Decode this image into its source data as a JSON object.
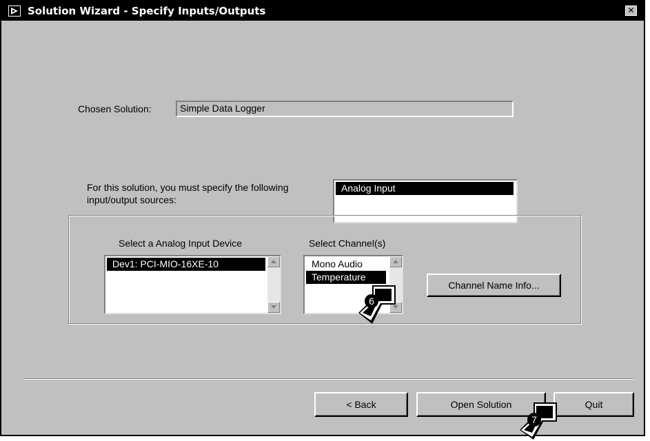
{
  "window": {
    "title": "Solution Wizard - Specify Inputs/Outputs"
  },
  "chosen_solution": {
    "label": "Chosen Solution:",
    "value": "Simple Data Logger"
  },
  "io_sources": {
    "instructions": "For this solution, you must specify the following input/output sources:",
    "line1": "For this solution, you must specify the following",
    "line2": "input/output sources:",
    "items": [
      "Analog Input"
    ],
    "selected": "Analog Input"
  },
  "device": {
    "label": "Select a Analog Input Device",
    "items": [
      "Dev1: PCI-MIO-16XE-10"
    ],
    "selected": "Dev1: PCI-MIO-16XE-10"
  },
  "channels": {
    "label": "Select Channel(s)",
    "items": [
      "Mono Audio",
      "Temperature"
    ],
    "selected": "Temperature"
  },
  "buttons": {
    "channel_name_info": "Channel Name Info...",
    "back": "< Back",
    "open_solution": "Open Solution",
    "quit": "Quit"
  },
  "callouts": {
    "step6": "6",
    "step7": "7"
  },
  "colors": {
    "face": "#c0c0c0",
    "titlebar": "#000000",
    "selection": "#000000"
  }
}
